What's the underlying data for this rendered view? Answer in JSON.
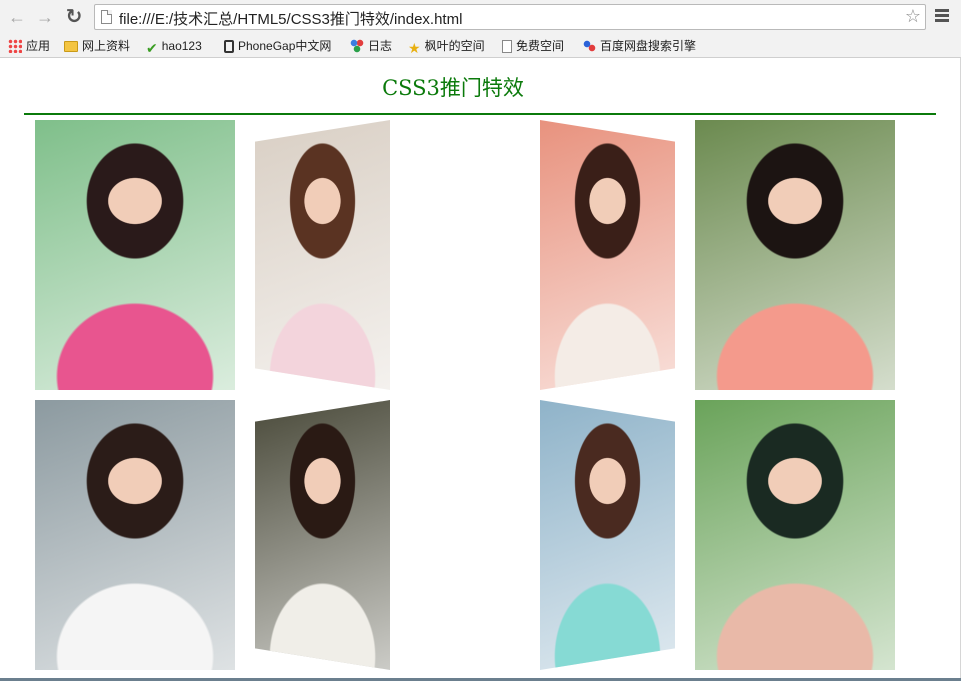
{
  "browser": {
    "url": "file:///E:/技术汇总/HTML5/CSS3推门特效/index.html",
    "back_icon": "arrow-left-icon",
    "forward_icon": "arrow-right-icon",
    "reload_icon": "reload-icon",
    "bookmark_icon": "star-icon",
    "menu_icon": "hamburger-menu-icon"
  },
  "bookmarks": [
    {
      "label": "应用",
      "icon": "apps-grid-icon"
    },
    {
      "label": "网上资料",
      "icon": "folder-icon"
    },
    {
      "label": "hao123",
      "icon": "hao123-icon"
    },
    {
      "label": "PhoneGap中文网",
      "icon": "phone-icon"
    },
    {
      "label": "日志",
      "icon": "circles-icon"
    },
    {
      "label": "枫叶的空间",
      "icon": "star-badge-icon"
    },
    {
      "label": "免费空间",
      "icon": "document-icon"
    },
    {
      "label": "百度网盘搜索引擎",
      "icon": "baidu-icon"
    }
  ],
  "page": {
    "title": "CSS3推门特效",
    "accent_color": "#0b7a0b"
  },
  "photos": [
    {
      "name": "photo-girl-pink-stripes",
      "palette": [
        "#7fbf8a",
        "#e8558f",
        "#2a1a1a"
      ]
    },
    {
      "name": "photo-girl-pink-sweater",
      "palette": [
        "#d9cfc4",
        "#f3d4dc",
        "#5a3322"
      ]
    },
    {
      "name": "photo-girl-blue-bow",
      "palette": [
        "#e8927e",
        "#f4ece6",
        "#3a1f18"
      ]
    },
    {
      "name": "photo-girl-flower-hair",
      "palette": [
        "#6b8a4f",
        "#f49a8c",
        "#1c1412"
      ]
    },
    {
      "name": "photo-girl-white-top",
      "palette": [
        "#8c9aa0",
        "#f5f5f5",
        "#2b1c18"
      ]
    },
    {
      "name": "photo-girl-floral-shirt",
      "palette": [
        "#4a4a3a",
        "#f0eee8",
        "#2a1a14"
      ]
    },
    {
      "name": "photo-girl-cyan-cardigan",
      "palette": [
        "#8fb3c9",
        "#86dad4",
        "#4a2a20"
      ]
    },
    {
      "name": "photo-girl-flower-crown",
      "palette": [
        "#6aa35a",
        "#e9b9a8",
        "#1a2a22"
      ]
    }
  ]
}
